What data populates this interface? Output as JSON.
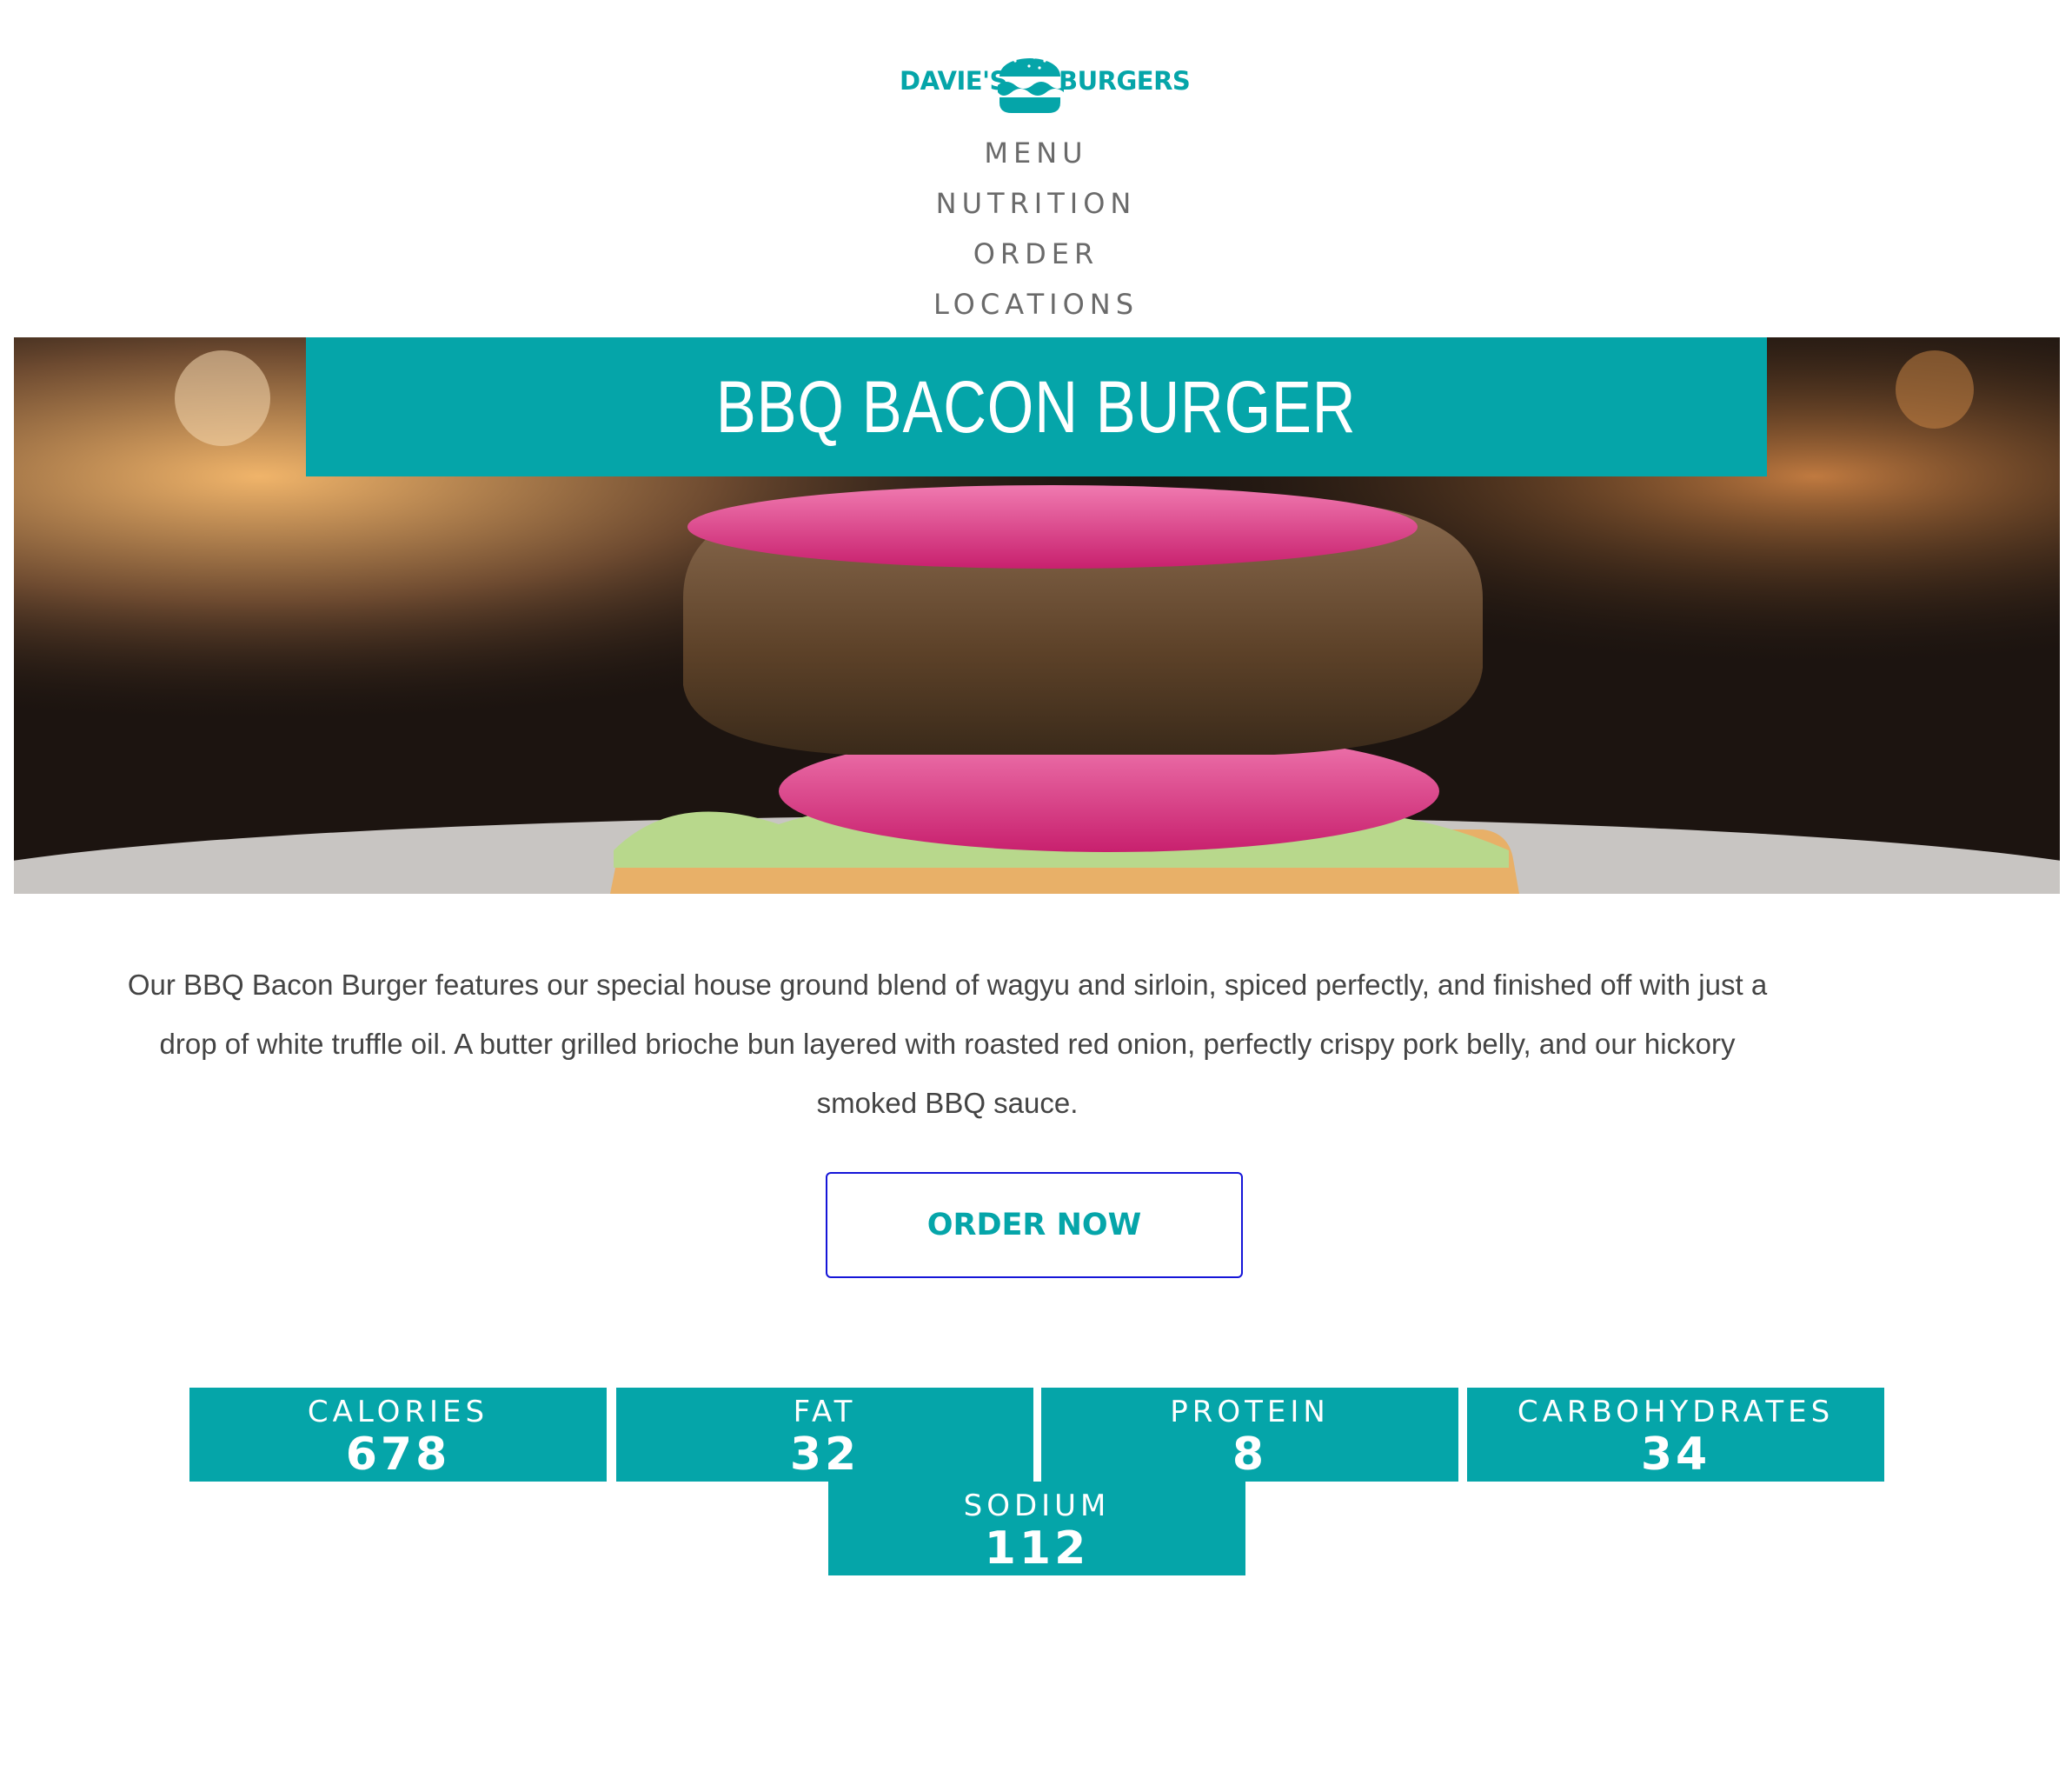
{
  "brand": {
    "left": "DAVIE'S",
    "right": "BURGERS",
    "color": "#05a5a9"
  },
  "nav": {
    "items": [
      "MENU",
      "NUTRITION",
      "ORDER",
      "LOCATIONS"
    ]
  },
  "hero": {
    "title": "BBQ BACON BURGER",
    "accent": "#05a5a9"
  },
  "description": "Our BBQ Bacon Burger features our special house ground blend of wagyu and sirloin, spiced perfectly, and finished off with just a drop of white truffle oil. A butter grilled brioche bun layered with roasted red onion, perfectly crispy pork belly, and our hickory smoked BBQ sauce.",
  "order_button": {
    "label": "ORDER NOW"
  },
  "nutrition": [
    {
      "label": "CALORIES",
      "value": "678"
    },
    {
      "label": "FAT",
      "value": "32"
    },
    {
      "label": "PROTEIN",
      "value": "8"
    },
    {
      "label": "CARBOHYDRATES",
      "value": "34"
    },
    {
      "label": "SODIUM",
      "value": "112"
    }
  ]
}
